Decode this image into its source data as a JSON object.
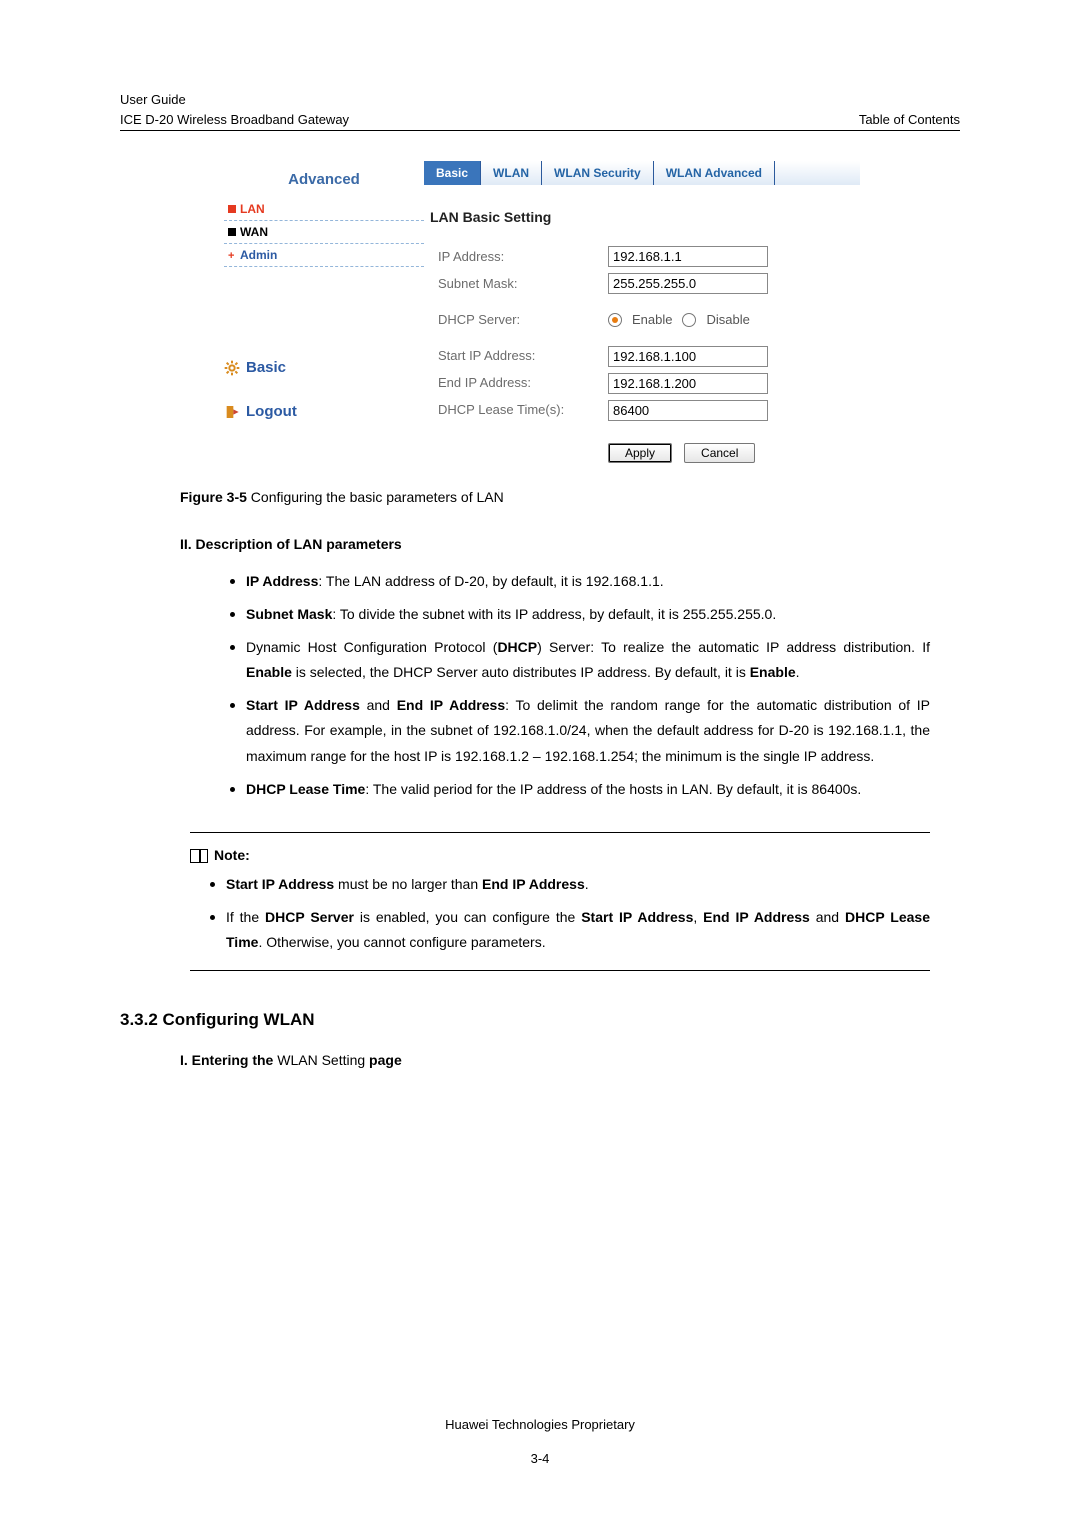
{
  "header": {
    "line1": "User Guide",
    "line2": "ICE D-20 Wireless Broadband Gateway",
    "right": "Table of Contents"
  },
  "screenshot": {
    "sidebar_title": "Advanced",
    "menu": {
      "lan": "LAN",
      "wan": "WAN",
      "admin": "Admin"
    },
    "basic_link": "Basic",
    "logout_link": "Logout",
    "tabs": {
      "basic": "Basic",
      "wlan": "WLAN",
      "wlan_sec": "WLAN Security",
      "wlan_adv": "WLAN Advanced"
    },
    "panel_title": "LAN Basic Setting",
    "labels": {
      "ip": "IP Address:",
      "mask": "Subnet Mask:",
      "dhcp": "DHCP Server:",
      "start": "Start IP Address:",
      "end": "End IP Address:",
      "lease": "DHCP Lease Time(s):"
    },
    "values": {
      "ip": "192.168.1.1",
      "mask": "255.255.255.0",
      "start": "192.168.1.100",
      "end": "192.168.1.200",
      "lease": "86400"
    },
    "radio": {
      "enable": "Enable",
      "disable": "Disable"
    },
    "buttons": {
      "apply": "Apply",
      "cancel": "Cancel"
    }
  },
  "figure_caption_prefix": "Figure 3-5",
  "figure_caption_text": " Configuring the basic parameters of LAN",
  "sectionII": "II. Description of LAN parameters",
  "bullets": {
    "b1a": "IP Address",
    "b1b": ": The LAN address of D-20, by default, it is 192.168.1.1.",
    "b2a": "Subnet Mask",
    "b2b": ": To divide the subnet with its IP address, by default, it is 255.255.255.0.",
    "b3a": "Dynamic Host Configuration Protocol (",
    "b3b": "DHCP",
    "b3c": ") Server: To realize the automatic IP address distribution. If ",
    "b3d": "Enable",
    "b3e": " is selected, the DHCP Server auto distributes IP address. By default, it is ",
    "b3f": "Enable",
    "b3g": ".",
    "b4a": "Start IP Address",
    "b4b": " and ",
    "b4c": "End IP Address",
    "b4d": ": To delimit the random range for the automatic distribution of IP address. For example, in the subnet of 192.168.1.0/24, when the default address for D-20 is 192.168.1.1, the maximum range for the host IP is 192.168.1.2 – 192.168.1.254; the minimum is the single IP address.",
    "b5a": "DHCP Lease Time",
    "b5b": ": The valid period for the IP address of the hosts in LAN. By default, it is 86400s."
  },
  "note_label": "Note:",
  "notes": {
    "n1a": "Start IP Address",
    "n1b": " must be no larger than ",
    "n1c": "End IP Address",
    "n1d": ".",
    "n2a": "If the ",
    "n2b": "DHCP Server",
    "n2c": " is enabled, you can configure the ",
    "n2d": "Start IP Address",
    "n2e": ", ",
    "n2f": "End IP Address",
    "n2g": " and ",
    "n2h": "DHCP Lease Time",
    "n2i": ". Otherwise, you cannot configure parameters."
  },
  "h3": "3.3.2  Configuring WLAN",
  "h4_prefix": "I. Entering the ",
  "h4_mid": "WLAN Setting",
  "h4_suffix": " page",
  "footer": {
    "line1": "Huawei Technologies Proprietary",
    "pagenum": "3-4"
  }
}
